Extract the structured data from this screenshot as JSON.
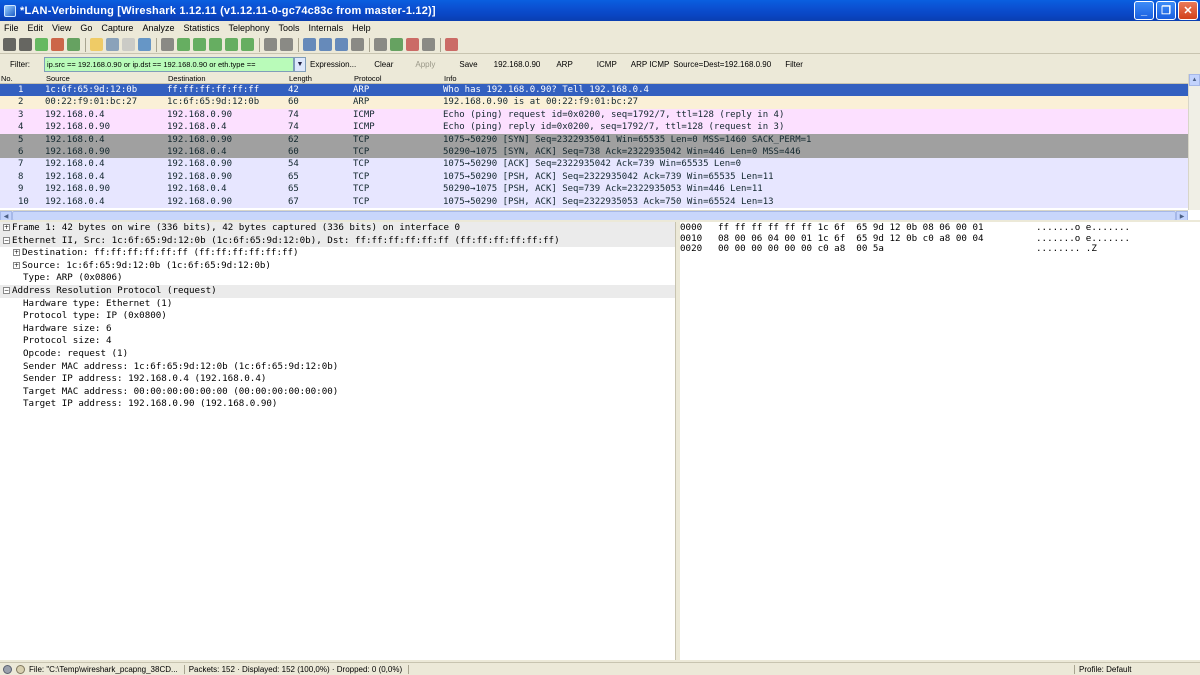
{
  "window": {
    "title": "*LAN-Verbindung  [Wireshark 1.12.11  (v1.12.11-0-gc74c83c from master-1.12)]",
    "buttons": [
      "_",
      "❐",
      "✕"
    ]
  },
  "menu": [
    "File",
    "Edit",
    "View",
    "Go",
    "Capture",
    "Analyze",
    "Statistics",
    "Telephony",
    "Tools",
    "Internals",
    "Help"
  ],
  "toolbar": {
    "icons": [
      "interface-list-icon",
      "capture-options-icon",
      "start-capture-icon",
      "stop-capture-icon",
      "restart-capture-icon",
      "open-file-icon",
      "save-file-icon",
      "close-file-icon",
      "reload-icon",
      "find-packet-icon",
      "go-back-icon",
      "go-forward-icon",
      "go-to-packet-icon",
      "first-packet-icon",
      "last-packet-icon",
      "colorize-icon",
      "auto-scroll-icon",
      "zoom-in-icon",
      "zoom-out-icon",
      "zoom-normal-icon",
      "resize-columns-icon",
      "capture-filters-icon",
      "display-filters-icon",
      "coloring-rules-icon",
      "preferences-icon",
      "help-icon"
    ],
    "colors": [
      "#3a3a3a",
      "#3a3a3a",
      "#3aa83a",
      "#c23a1a",
      "#3a8a3a",
      "#f0c040",
      "#6a8ab0",
      "#c0c0c0",
      "#3a7ac0",
      "#6a6a6a",
      "#3a9a3a",
      "#3a9a3a",
      "#3a9a3a",
      "#3a9a3a",
      "#3a9a3a",
      "#6a6a6a",
      "#6a6a6a",
      "#3a6ab0",
      "#3a6ab0",
      "#3a6ab0",
      "#6a6a6a",
      "#6a6a6a",
      "#3a8a3a",
      "#c04040",
      "#6a6a6a",
      "#c04040"
    ]
  },
  "filter": {
    "label": "Filter:",
    "value": "ip.src == 192.168.0.90 or ip.dst == 192.168.0.90 or eth.type ==",
    "buttons": [
      "Expression...",
      "Clear",
      "Apply",
      "Save",
      "192.168.0.90",
      "ARP",
      "ICMP",
      "ARP ICMP",
      "Source=Dest=192.168.0.90",
      "Filter"
    ]
  },
  "packet_list": {
    "columns": [
      "No.",
      "Source",
      "Destination",
      "Length",
      "Protocol",
      "Info"
    ],
    "rows": [
      {
        "no": "1",
        "src": "1c:6f:65:9d:12:0b",
        "dst": "ff:ff:ff:ff:ff:ff",
        "len": "42",
        "proto": "ARP",
        "info": "Who has 192.168.0.90?  Tell 192.168.0.4",
        "bg": "#3360c0",
        "fg": "#ffffff"
      },
      {
        "no": "2",
        "src": "00:22:f9:01:bc:27",
        "dst": "1c:6f:65:9d:12:0b",
        "len": "60",
        "proto": "ARP",
        "info": "192.168.0.90 is at 00:22:f9:01:bc:27",
        "bg": "#faf0d7",
        "fg": "#12272e"
      },
      {
        "no": "3",
        "src": "192.168.0.4",
        "dst": "192.168.0.90",
        "len": "74",
        "proto": "ICMP",
        "info": "Echo (ping) request  id=0x0200, seq=1792/7, ttl=128 (reply in 4)",
        "bg": "#fce0ff",
        "fg": "#12272e"
      },
      {
        "no": "4",
        "src": "192.168.0.90",
        "dst": "192.168.0.4",
        "len": "74",
        "proto": "ICMP",
        "info": "Echo (ping) reply    id=0x0200, seq=1792/7, ttl=128 (request in 3)",
        "bg": "#fce0ff",
        "fg": "#12272e"
      },
      {
        "no": "5",
        "src": "192.168.0.4",
        "dst": "192.168.0.90",
        "len": "62",
        "proto": "TCP",
        "info": "1075→50290 [SYN] Seq=2322935041 Win=65535 Len=0 MSS=1460 SACK_PERM=1",
        "bg": "#a0a0a0",
        "fg": "#12272e"
      },
      {
        "no": "6",
        "src": "192.168.0.90",
        "dst": "192.168.0.4",
        "len": "60",
        "proto": "TCP",
        "info": "50290→1075 [SYN, ACK] Seq=738 Ack=2322935042 Win=446 Len=0 MSS=446",
        "bg": "#a0a0a0",
        "fg": "#12272e"
      },
      {
        "no": "7",
        "src": "192.168.0.4",
        "dst": "192.168.0.90",
        "len": "54",
        "proto": "TCP",
        "info": "1075→50290 [ACK] Seq=2322935042 Ack=739 Win=65535 Len=0",
        "bg": "#e7e6ff",
        "fg": "#12272e"
      },
      {
        "no": "8",
        "src": "192.168.0.4",
        "dst": "192.168.0.90",
        "len": "65",
        "proto": "TCP",
        "info": "1075→50290 [PSH, ACK] Seq=2322935042 Ack=739 Win=65535 Len=11",
        "bg": "#e7e6ff",
        "fg": "#12272e"
      },
      {
        "no": "9",
        "src": "192.168.0.90",
        "dst": "192.168.0.4",
        "len": "65",
        "proto": "TCP",
        "info": "50290→1075 [PSH, ACK] Seq=739 Ack=2322935053 Win=446 Len=11",
        "bg": "#e7e6ff",
        "fg": "#12272e"
      },
      {
        "no": "10",
        "src": "192.168.0.4",
        "dst": "192.168.0.90",
        "len": "67",
        "proto": "TCP",
        "info": "1075→50290 [PSH, ACK] Seq=2322935053 Ack=750 Win=65524 Len=13",
        "bg": "#e7e6ff",
        "fg": "#12272e"
      }
    ]
  },
  "details": [
    {
      "indent": 0,
      "exp": "⊞",
      "sect": true,
      "text": "Frame 1: 42 bytes on wire (336 bits), 42 bytes captured (336 bits) on interface 0"
    },
    {
      "indent": 0,
      "exp": "⊟",
      "sect": true,
      "text": "Ethernet II, Src: 1c:6f:65:9d:12:0b (1c:6f:65:9d:12:0b), Dst: ff:ff:ff:ff:ff:ff (ff:ff:ff:ff:ff:ff)"
    },
    {
      "indent": 1,
      "exp": "⊞",
      "sect": false,
      "text": "Destination: ff:ff:ff:ff:ff:ff (ff:ff:ff:ff:ff:ff)"
    },
    {
      "indent": 1,
      "exp": "⊞",
      "sect": false,
      "text": "Source: 1c:6f:65:9d:12:0b (1c:6f:65:9d:12:0b)"
    },
    {
      "indent": 2,
      "exp": "",
      "sect": false,
      "text": "Type: ARP (0x0806)"
    },
    {
      "indent": 0,
      "exp": "⊟",
      "sect": true,
      "text": "Address Resolution Protocol (request)"
    },
    {
      "indent": 2,
      "exp": "",
      "sect": false,
      "text": "Hardware type: Ethernet (1)"
    },
    {
      "indent": 2,
      "exp": "",
      "sect": false,
      "text": "Protocol type: IP (0x0800)"
    },
    {
      "indent": 2,
      "exp": "",
      "sect": false,
      "text": "Hardware size: 6"
    },
    {
      "indent": 2,
      "exp": "",
      "sect": false,
      "text": "Protocol size: 4"
    },
    {
      "indent": 2,
      "exp": "",
      "sect": false,
      "text": "Opcode: request (1)"
    },
    {
      "indent": 2,
      "exp": "",
      "sect": false,
      "text": "Sender MAC address: 1c:6f:65:9d:12:0b (1c:6f:65:9d:12:0b)"
    },
    {
      "indent": 2,
      "exp": "",
      "sect": false,
      "text": "Sender IP address: 192.168.0.4 (192.168.0.4)"
    },
    {
      "indent": 2,
      "exp": "",
      "sect": false,
      "text": "Target MAC address: 00:00:00:00:00:00 (00:00:00:00:00:00)"
    },
    {
      "indent": 2,
      "exp": "",
      "sect": false,
      "text": "Target IP address: 192.168.0.90 (192.168.0.90)"
    }
  ],
  "bytes": [
    {
      "offset": "0000",
      "hex": "ff ff ff ff ff ff 1c 6f  65 9d 12 0b 08 06 00 01",
      "ascii": ".......o e......."
    },
    {
      "offset": "0010",
      "hex": "08 00 06 04 00 01 1c 6f  65 9d 12 0b c0 a8 00 04",
      "ascii": ".......o e......."
    },
    {
      "offset": "0020",
      "hex": "00 00 00 00 00 00 c0 a8  00 5a",
      "ascii": "........ .Z"
    }
  ],
  "status": {
    "file": "File: \"C:\\Temp\\wireshark_pcapng_38CD...",
    "packets": "Packets: 152 · Displayed: 152 (100,0%) · Dropped: 0 (0,0%)",
    "profile": "Profile: Default"
  }
}
